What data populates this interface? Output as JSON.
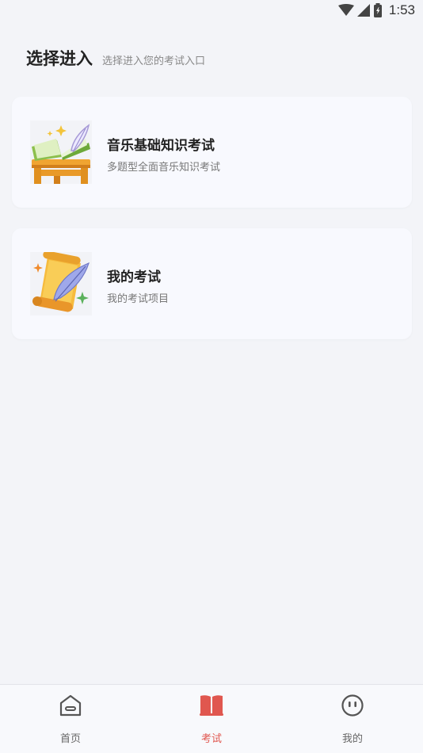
{
  "status": {
    "time": "1:53"
  },
  "header": {
    "title": "选择进入",
    "subtitle": "选择进入您的考试入口"
  },
  "cards": [
    {
      "title": "音乐基础知识考试",
      "desc": "多题型全面音乐知识考试",
      "icon": "book-quill-icon"
    },
    {
      "title": "我的考试",
      "desc": "我的考试项目",
      "icon": "scroll-quill-icon"
    }
  ],
  "tabbar": {
    "tabs": [
      {
        "label": "首页",
        "icon": "home-icon"
      },
      {
        "label": "考试",
        "icon": "book-icon",
        "active": true
      },
      {
        "label": "我的",
        "icon": "face-icon"
      }
    ],
    "active_color": "#e0574f"
  }
}
